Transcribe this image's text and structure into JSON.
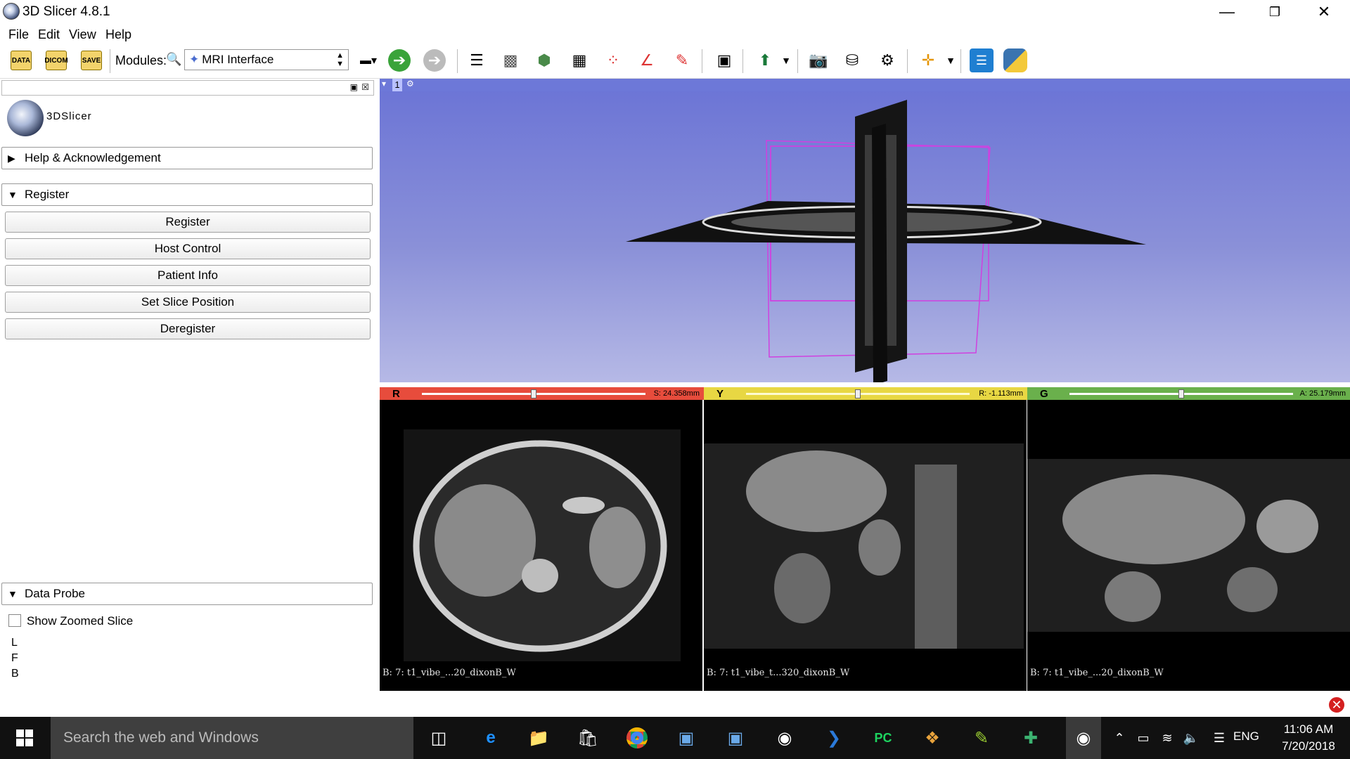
{
  "window": {
    "title": "3D Slicer 4.8.1"
  },
  "menu": [
    "File",
    "Edit",
    "View",
    "Help"
  ],
  "toolbar": {
    "data_label": "DATA",
    "dicom_label": "DICOM",
    "save_label": "SAVE",
    "modules_label": "Modules:",
    "module_selected": "MRI Interface"
  },
  "panel": {
    "logo_text": "3DSlicer",
    "help_section": "Help & Acknowledgement",
    "register_section": "Register",
    "buttons": [
      "Register",
      "Host Control",
      "Patient Info",
      "Set Slice Position",
      "Deregister"
    ],
    "data_probe_section": "Data Probe",
    "show_zoomed_slice": "Show Zoomed Slice",
    "probe_rows": [
      "L",
      "F",
      "B"
    ]
  },
  "view3d": {
    "number": "1"
  },
  "slice_views": [
    {
      "label": "R",
      "value": "S: 24.358mm",
      "color": "#e74c3c",
      "slider": 0.5,
      "caption": "B: 7: t1_vibe_...20_dixonB_W"
    },
    {
      "label": "Y",
      "value": "R: -1.113mm",
      "color": "#e8d743",
      "slider": 0.5,
      "caption": "B: 7: t1_vibe_t...320_dixonB_W"
    },
    {
      "label": "G",
      "value": "A: 25.179mm",
      "color": "#6ab04c",
      "slider": 0.5,
      "caption": "B: 7: t1_vibe_...20_dixonB_W"
    }
  ],
  "taskbar": {
    "search_placeholder": "Search the web and Windows",
    "language": "ENG",
    "time": "11:06 AM",
    "date": "7/20/2018"
  }
}
